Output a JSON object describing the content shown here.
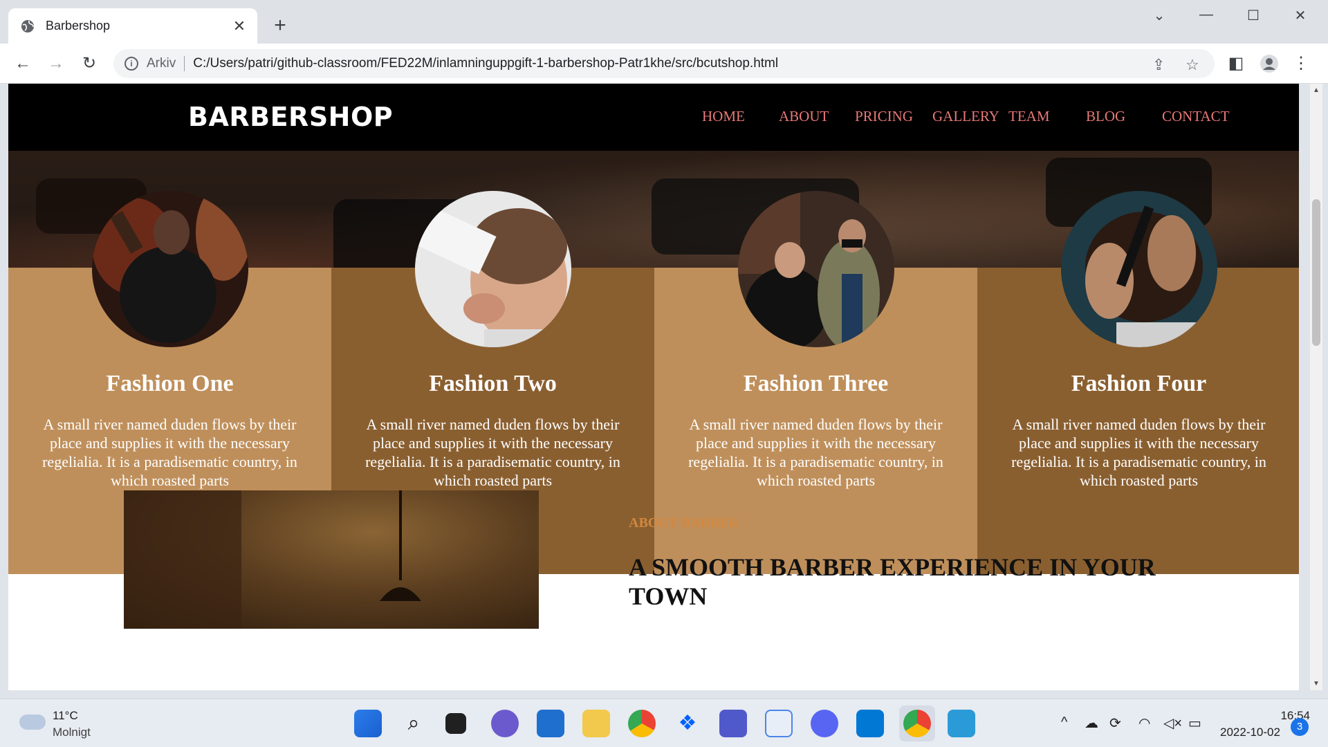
{
  "browser": {
    "tab_title": "Barbershop",
    "omnibox_chip": "Arkiv",
    "url": "C:/Users/patri/github-classroom/FED22M/inlamninguppgift-1-barbershop-Patr1khe/src/bcutshop.html"
  },
  "site": {
    "logo": "BARBERSHOP",
    "nav": [
      "HOME",
      "ABOUT",
      "PRICING",
      "GALLERY",
      "TEAM",
      "BLOG",
      "CONTACT"
    ],
    "nav_color": "#e97878"
  },
  "features": [
    {
      "title": "Fashion One",
      "text": "A small river named duden flows by their place and supplies it with the necessary regelialia. It is a paradisematic country, in which roasted parts"
    },
    {
      "title": "Fashion Two",
      "text": "A small river named duden flows by their place and supplies it with the necessary regelialia. It is a paradisematic country, in which roasted parts"
    },
    {
      "title": "Fashion Three",
      "text": "A small river named duden flows by their place and supplies it with the necessary regelialia. It is a paradisematic country, in which roasted parts"
    },
    {
      "title": "Fashion Four",
      "text": "A small river named duden flows by their place and supplies it with the necessary regelialia. It is a paradisematic country, in which roasted parts"
    }
  ],
  "colors": {
    "column_light": "#bf8f5b",
    "column_dark": "#8a5f30",
    "accent": "#d2883f"
  },
  "about": {
    "kicker": "ABOUT BARBER",
    "title": "A SMOOTH BARBER EXPERIENCE IN YOUR TOWN"
  },
  "taskbar": {
    "temperature": "11°C",
    "weather": "Molnigt",
    "time": "16:54",
    "date": "2022-10-02",
    "notifications": "3"
  }
}
